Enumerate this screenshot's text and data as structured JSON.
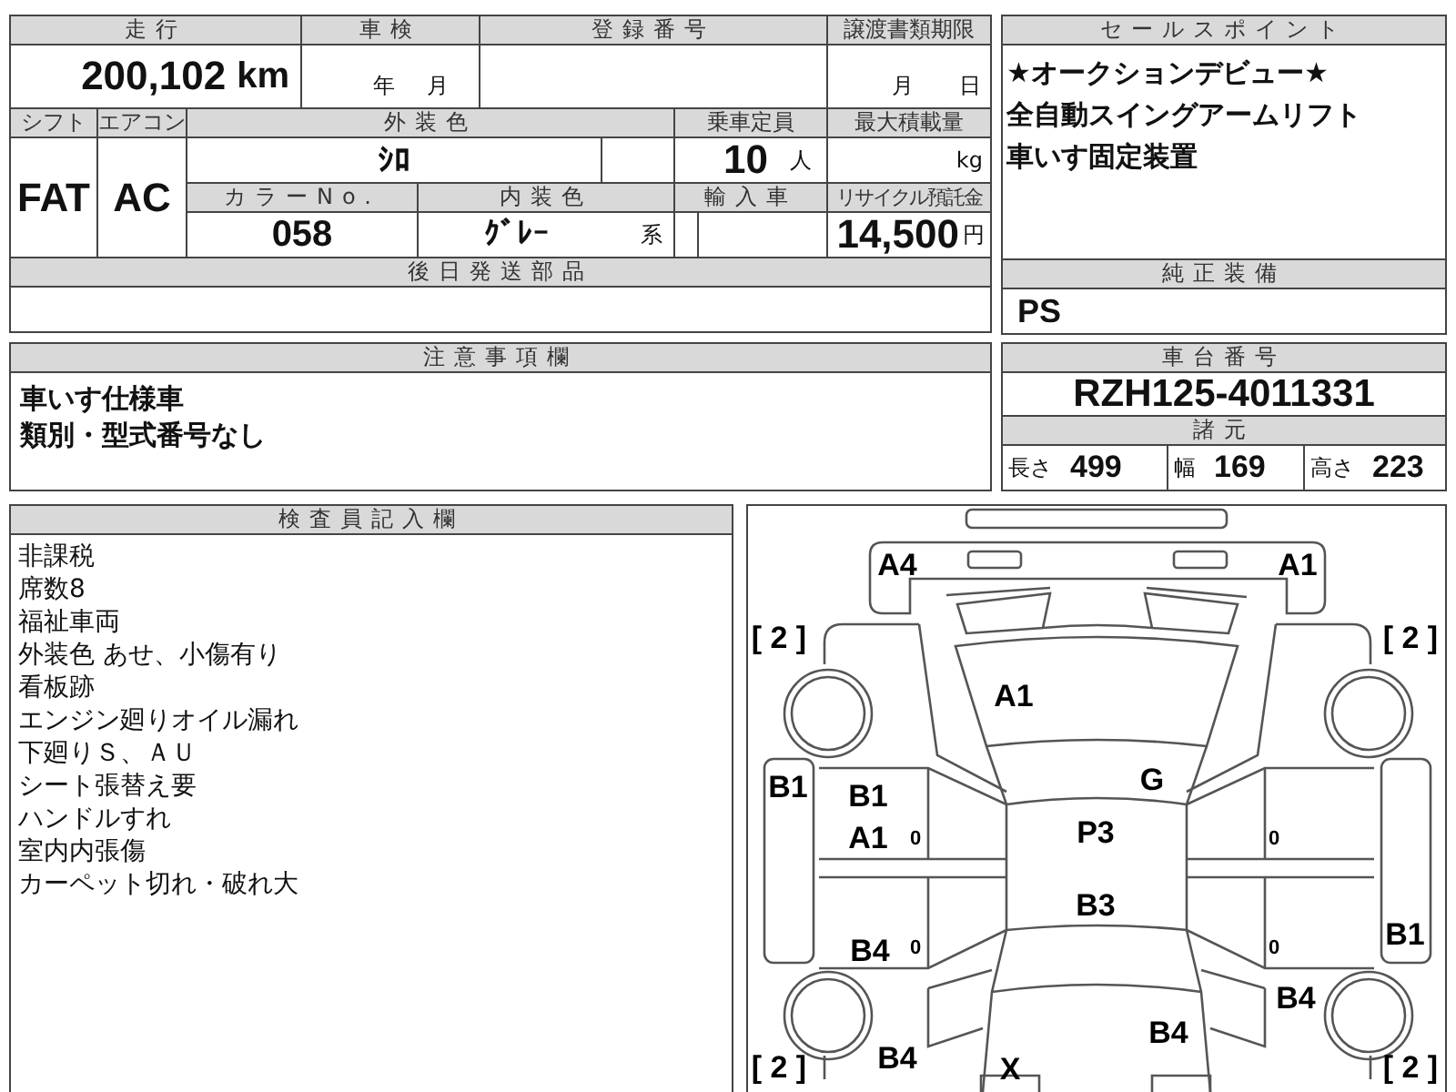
{
  "vehicle_table": {
    "mileage": {
      "label": "走行",
      "value": "200,102",
      "unit": "km"
    },
    "inspection": {
      "label": "車検",
      "year_unit": "年",
      "month_unit": "月"
    },
    "registration": {
      "label": "登録番号"
    },
    "transfer_deadline": {
      "label": "譲渡書類期限",
      "month_unit": "月",
      "day_unit": "日"
    },
    "shift": {
      "label": "シフト",
      "value": "FAT"
    },
    "aircon": {
      "label": "エアコン",
      "value": "AC"
    },
    "exterior_color": {
      "label": "外装色",
      "value": "ｼﾛ"
    },
    "capacity": {
      "label": "乗車定員",
      "value": "10",
      "unit": "人"
    },
    "max_load": {
      "label": "最大積載量",
      "unit": "kg"
    },
    "color_no": {
      "label": "カラーNo.",
      "value": "058"
    },
    "interior_color": {
      "label": "内装色",
      "value": "ｸﾞﾚｰ",
      "suffix": "系"
    },
    "imported": {
      "label": "輸入車"
    },
    "recycle_fee": {
      "label": "リサイクル預託金",
      "value": "14,500",
      "unit": "円"
    },
    "parts_to_send": {
      "label": "後日発送部品"
    }
  },
  "sales_points": {
    "label": "セールスポイント",
    "lines": [
      "★オークションデビュー★",
      "全自動スイングアームリフト",
      "車いす固定装置"
    ]
  },
  "factory_equipment": {
    "label": "純正装備",
    "value": "PS"
  },
  "notes": {
    "label": "注意事項欄",
    "lines": [
      "車いす仕様車",
      "類別・型式番号なし"
    ]
  },
  "chassis": {
    "label": "車台番号",
    "value": "RZH125-4011331"
  },
  "specs": {
    "label": "諸元",
    "items": [
      {
        "label": "長さ",
        "value": "499"
      },
      {
        "label": "幅",
        "value": "169"
      },
      {
        "label": "高さ",
        "value": "223"
      }
    ]
  },
  "inspector_notes": {
    "label": "検査員記入欄",
    "lines": [
      "非課税",
      "席数8",
      "福祉車両",
      "外装色 あせ、小傷有り",
      "看板跡",
      "エンジン廻りオイル漏れ",
      "下廻りＳ、ＡＵ",
      "シート張替え要",
      "ハンドルすれ",
      "室内内張傷",
      "カーペット切れ・破れ大"
    ]
  },
  "damage_diagram": {
    "marks": [
      "A4",
      "A1",
      "A1",
      "G",
      "B1",
      "B1",
      "A1",
      "P3",
      "B3",
      "B1",
      "B4",
      "B4",
      "B4",
      "B4",
      "X"
    ],
    "tire_marks": [
      "[ 2 ]",
      "[ 2 ]",
      "[ 2 ]",
      "[ 2 ]"
    ],
    "door_marks": [
      "0",
      "0",
      "0",
      "0"
    ]
  }
}
